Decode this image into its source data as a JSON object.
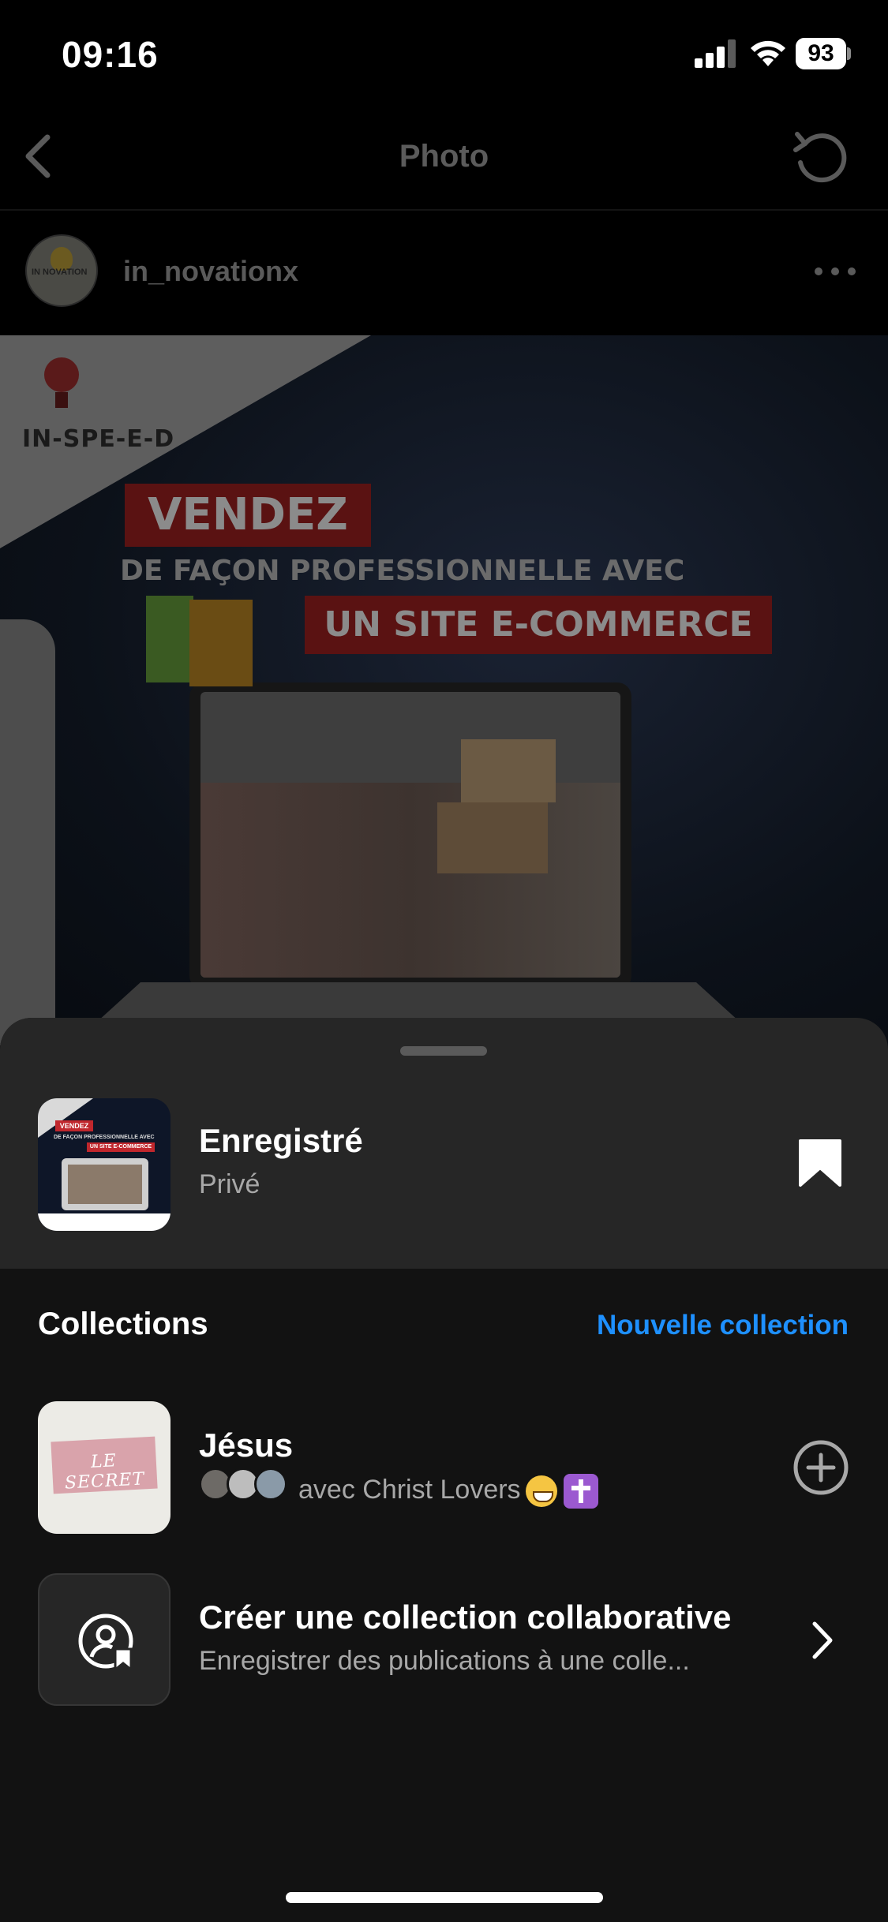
{
  "status_bar": {
    "time": "09:16",
    "battery": "93",
    "icons": [
      "signal-icon",
      "wifi-icon",
      "battery-icon"
    ]
  },
  "nav": {
    "title": "Photo",
    "icons": [
      "back-icon",
      "refresh-icon"
    ]
  },
  "post": {
    "username": "in_novationx",
    "avatar_text": "IN NOVATION",
    "image": {
      "brand": "IN-SPE-E-D",
      "headline": "VENDEZ",
      "line2": "DE FAÇON PROFESSIONNELLE AVEC",
      "line3": "UN SITE E-COMMERCE"
    }
  },
  "sheet": {
    "saved": {
      "title": "Enregistré",
      "subtitle": "Privé",
      "thumb_headline": "VENDEZ",
      "thumb_line2": "DE FAÇON PROFESSIONNELLE AVEC",
      "thumb_line3": "UN SITE E-COMMERCE",
      "icon": "bookmark-filled-icon"
    },
    "collections_label": "Collections",
    "new_collection_label": "Nouvelle collection",
    "collections": [
      {
        "title": "Jésus",
        "subtitle": "avec Christ Lovers",
        "thumb_text": "LE SECRET",
        "action_icon": "add-circle-icon"
      },
      {
        "title": "Créer une collection collaborative",
        "subtitle": "Enregistrer des publications à une colle...",
        "action_icon": "chevron-right-icon"
      }
    ]
  },
  "colors": {
    "accent": "#1e90ff",
    "sheet_top": "#262626",
    "sheet_bg": "#121212",
    "secondary_text": "#a8a8a8"
  }
}
